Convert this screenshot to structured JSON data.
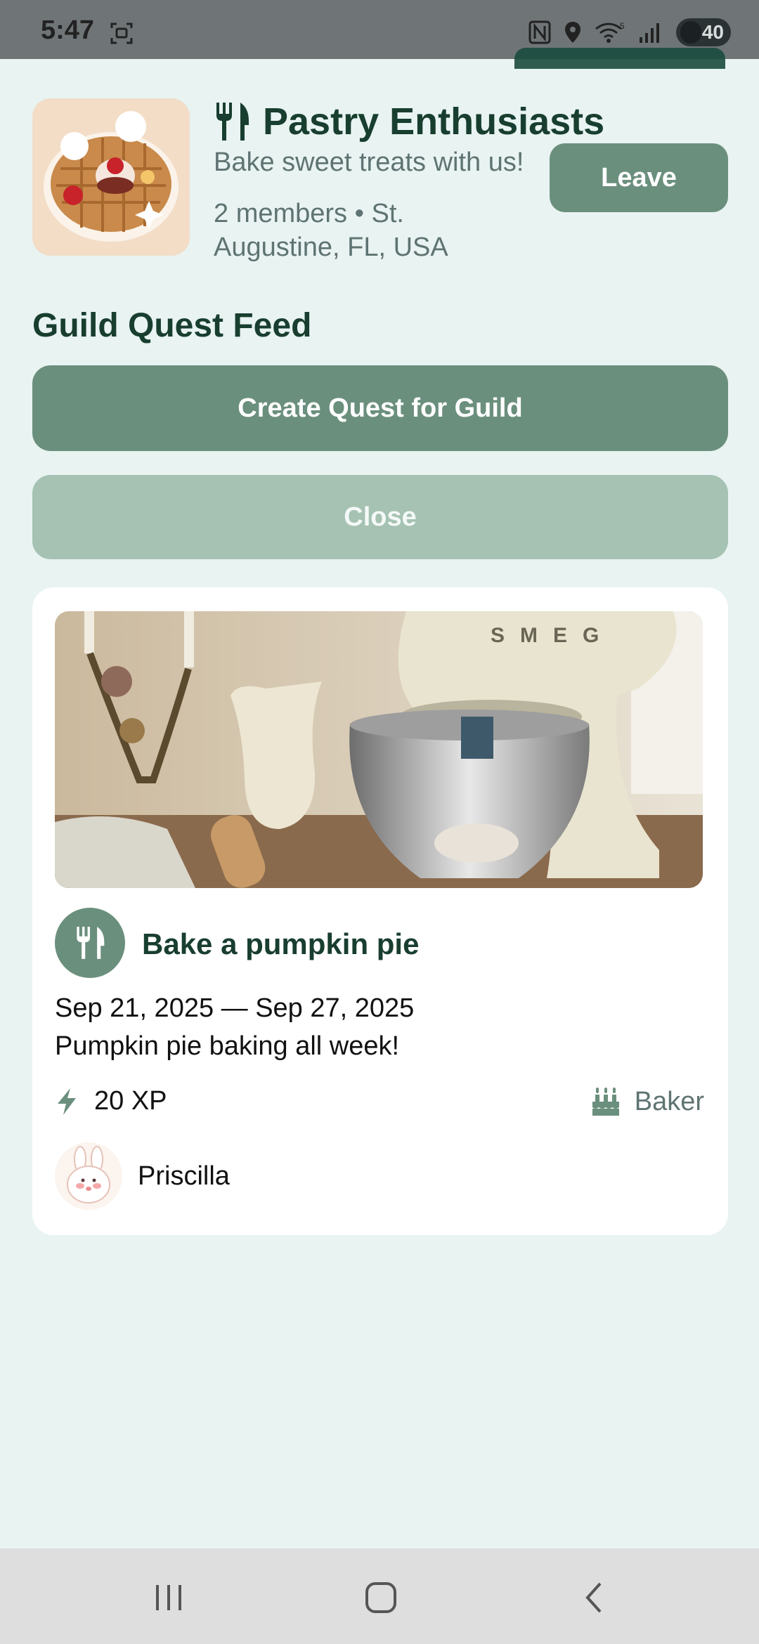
{
  "status_bar": {
    "time": "5:47",
    "battery": "40",
    "wifi_label": "5"
  },
  "guild": {
    "name": "Pastry Enthusiasts",
    "tagline": "Bake sweet treats with us!",
    "meta": "2 members • St. Augustine, FL, USA",
    "leave_label": "Leave"
  },
  "feed": {
    "title": "Guild Quest Feed",
    "create_label": "Create Quest for Guild",
    "close_label": "Close"
  },
  "quest": {
    "title": "Bake a pumpkin pie",
    "dates": "Sep 21, 2025 — Sep 27, 2025",
    "description": "Pumpkin pie baking all week!",
    "xp": "20 XP",
    "category": "Baker",
    "member": "Priscilla"
  },
  "colors": {
    "accent": "#6b8f7d",
    "accent_light": "#a5c2b3",
    "heading": "#183e2f",
    "background": "#e8f3f2"
  }
}
